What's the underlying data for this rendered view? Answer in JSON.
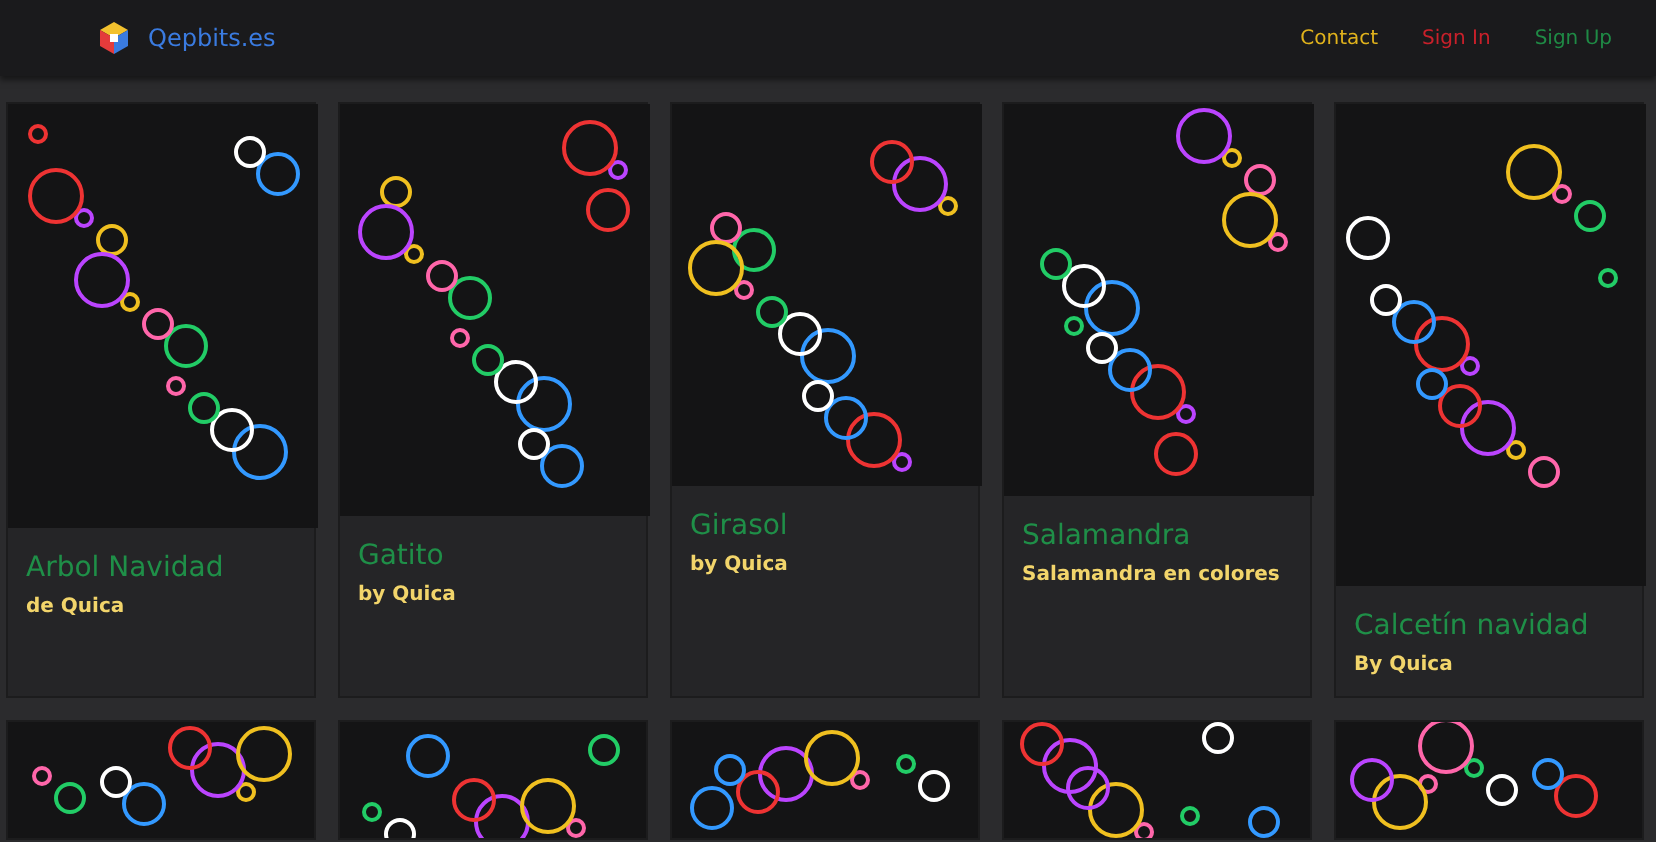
{
  "brand": {
    "name": "Qepbits.es"
  },
  "nav": [
    {
      "label": "Contact",
      "color": "#e0b21c"
    },
    {
      "label": "Sign In",
      "color": "#c8202a"
    },
    {
      "label": "Sign Up",
      "color": "#1f8a45"
    }
  ],
  "cards": [
    {
      "kind": "full",
      "title": "Arbol Navidad",
      "subtitle": "de Quica"
    },
    {
      "kind": "full",
      "title": "Gatito",
      "subtitle": "by Quica"
    },
    {
      "kind": "full",
      "title": "Girasol",
      "subtitle": "by Quica"
    },
    {
      "kind": "full",
      "title": "Salamandra",
      "subtitle": "Salamandra en colores"
    },
    {
      "kind": "full",
      "title": "Calcetín navidad",
      "subtitle": "By Quica"
    },
    {
      "kind": "cut"
    },
    {
      "kind": "cut"
    },
    {
      "kind": "cut"
    },
    {
      "kind": "cut"
    },
    {
      "kind": "cut"
    }
  ]
}
